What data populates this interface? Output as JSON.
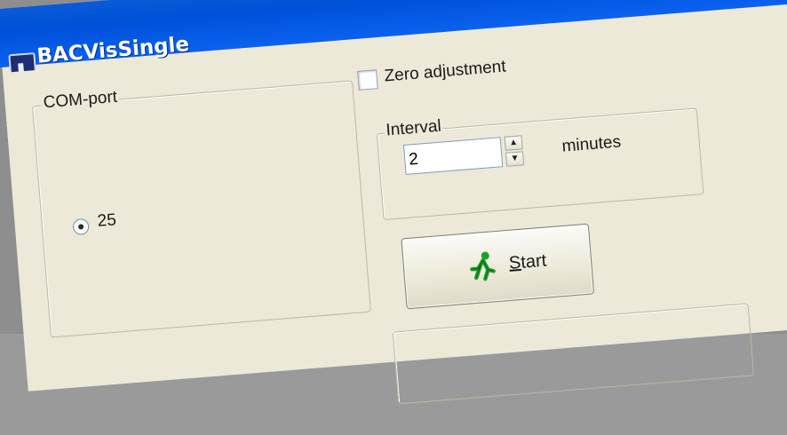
{
  "window": {
    "title": "BACVisSingle",
    "app_icon": "bacvis-app-icon"
  },
  "options": {
    "zero_adjustment_label": "Zero adjustment",
    "zero_adjustment_checked": false
  },
  "com_port": {
    "group_label": "COM-port",
    "selected_port": "25"
  },
  "interval": {
    "group_label": "Interval",
    "value": "2",
    "unit": "minutes"
  },
  "start_button": {
    "label_first": "S",
    "label_rest": "tart",
    "icon": "running-man-icon"
  },
  "colors": {
    "titlebar": "#0050d8",
    "window_bg": "#ece9d8",
    "frame_bg": "#8e8e8e",
    "runner_green": "#1aa12a"
  }
}
